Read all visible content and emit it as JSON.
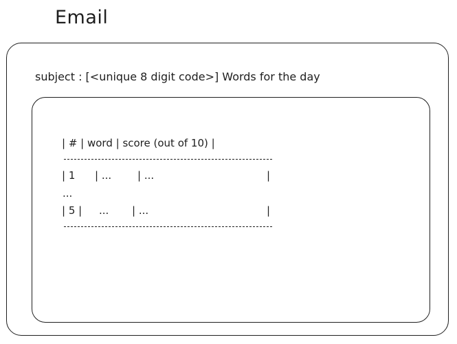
{
  "title": "Email",
  "subject": "subject : [<unique 8 digit code>] Words for the day",
  "table": {
    "header": "| # | word | score (out of 10) |",
    "rows": [
      {
        "num": "| 1",
        "word": "| ...",
        "score": "| ...",
        "end": "|"
      },
      {
        "num": "| 5 |",
        "word": "...",
        "score": "| ...",
        "end": "|"
      }
    ],
    "ellipsis": "..."
  }
}
